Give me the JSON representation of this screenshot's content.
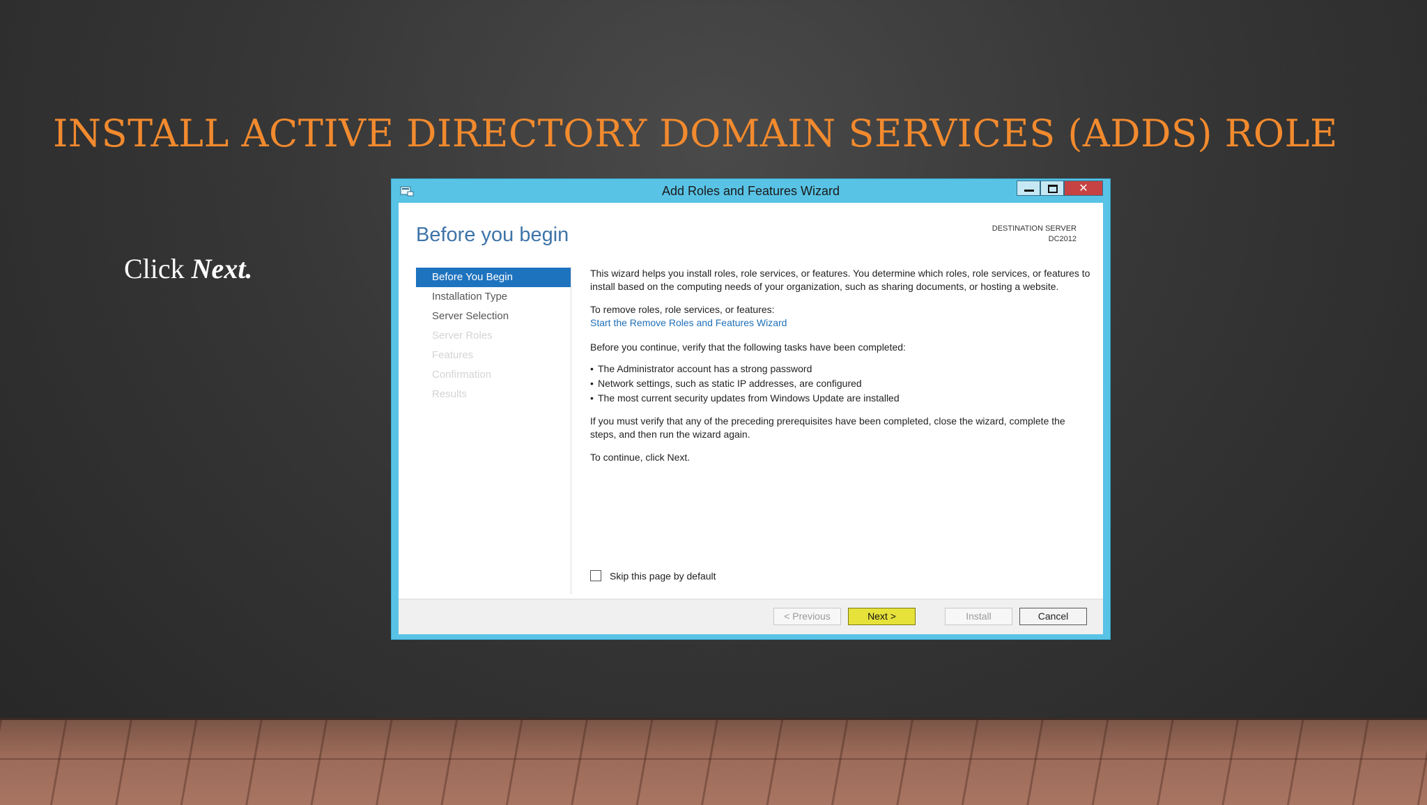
{
  "slide": {
    "title": "INSTALL ACTIVE DIRECTORY DOMAIN SERVICES (ADDS) ROLE",
    "instruction_prefix": "Click",
    "instruction_emphasis": "Next."
  },
  "window": {
    "title": "Add Roles and Features Wizard",
    "close_glyph": "✕"
  },
  "wizard": {
    "heading": "Before you begin",
    "destination_label": "DESTINATION SERVER",
    "destination_value": "DC2012",
    "nav": [
      {
        "label": "Before You Begin",
        "state": "active"
      },
      {
        "label": "Installation Type",
        "state": "enabled"
      },
      {
        "label": "Server Selection",
        "state": "enabled"
      },
      {
        "label": "Server Roles",
        "state": "disabled"
      },
      {
        "label": "Features",
        "state": "disabled"
      },
      {
        "label": "Confirmation",
        "state": "disabled"
      },
      {
        "label": "Results",
        "state": "disabled"
      }
    ],
    "intro": "This wizard helps you install roles, role services, or features. You determine which roles, role services, or features to install based on the computing needs of your organization, such as sharing documents, or hosting a website.",
    "remove_label": "To remove roles, role services, or features:",
    "remove_link": "Start the Remove Roles and Features Wizard",
    "verify_intro": "Before you continue, verify that the following tasks have been completed:",
    "tasks": [
      "The Administrator account has a strong password",
      "Network settings, such as static IP addresses, are configured",
      "The most current security updates from Windows Update are installed"
    ],
    "verify_note": "If you must verify that any of the preceding prerequisites have been completed, close the wizard, complete the steps, and then run the wizard again.",
    "continue_note": "To continue, click Next.",
    "skip_label": "Skip this page by default",
    "skip_checked": false,
    "buttons": {
      "previous": "< Previous",
      "next": "Next >",
      "install": "Install",
      "cancel": "Cancel"
    }
  }
}
